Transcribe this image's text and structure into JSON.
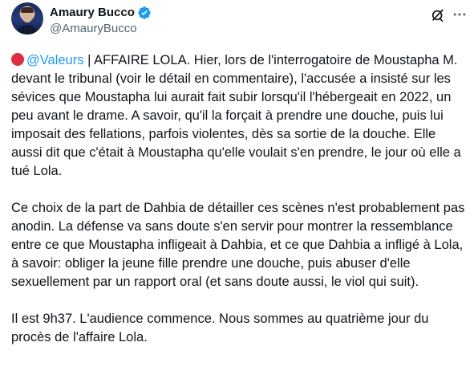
{
  "author": {
    "name": "Amaury Bucco",
    "handle": "@AmauryBucco",
    "verified_color": "#1d9bf0"
  },
  "actions": {
    "grok_icon": "grok-slash-icon",
    "more_icon": "more-dots-icon"
  },
  "tweet": {
    "p1_mention": "@Valeurs",
    "p1_text": " | AFFAIRE LOLA. Hier, lors de l'interrogatoire de Moustapha M. devant le tribunal (voir le détail en commentaire), l'accusée a insisté sur les sévices que Moustapha lui aurait fait subir lorsqu'il l'hébergeait en 2022, un peu avant le drame. A savoir, qu'il la forçait à prendre une douche, puis lui imposait des fellations, parfois violentes, dès sa sortie de la douche. Elle aussi dit que c'était à Moustapha qu'elle voulait s'en prendre, le jour où elle a tué Lola.",
    "p2_text": "Ce choix de la part de Dahbia de détailler ces scènes n'est probablement pas anodin. La défense va sans doute s'en servir pour montrer la ressemblance entre ce que Moustapha infligeait à Dahbia, et ce que Dahbia a infligé à Lola, à savoir: obliger la jeune fille prendre une douche, puis abuser d'elle sexuellement par un rapport oral (et sans doute aussi, le viol qui suit).",
    "p3_text": "Il est 9h37. L'audience commence. Nous sommes au quatrième jour du procès de l'affaire Lola."
  }
}
